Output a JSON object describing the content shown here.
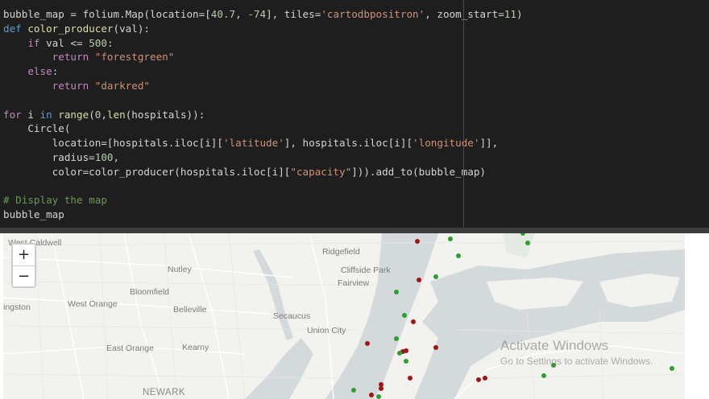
{
  "code_cell": {
    "lines": [
      [
        {
          "t": "bubble_map = folium.Map(location=[",
          "c": ""
        },
        {
          "t": "40.7",
          "c": "num"
        },
        {
          "t": ", ",
          "c": ""
        },
        {
          "t": "-74",
          "c": "num"
        },
        {
          "t": "], tiles=",
          "c": ""
        },
        {
          "t": "'cartodbpositron'",
          "c": "str"
        },
        {
          "t": ", zoom_start=",
          "c": ""
        },
        {
          "t": "11",
          "c": "num"
        },
        {
          "t": ")",
          "c": ""
        }
      ],
      [
        {
          "t": "def",
          "c": "kw"
        },
        {
          "t": " ",
          "c": ""
        },
        {
          "t": "color_producer",
          "c": "fn"
        },
        {
          "t": "(val):",
          "c": ""
        }
      ],
      [
        {
          "t": "    ",
          "c": ""
        },
        {
          "t": "if",
          "c": "ctrl"
        },
        {
          "t": " val <= ",
          "c": ""
        },
        {
          "t": "500",
          "c": "num"
        },
        {
          "t": ":",
          "c": ""
        }
      ],
      [
        {
          "t": "        ",
          "c": ""
        },
        {
          "t": "return",
          "c": "ctrl"
        },
        {
          "t": " ",
          "c": ""
        },
        {
          "t": "\"forestgreen\"",
          "c": "str"
        }
      ],
      [
        {
          "t": "    ",
          "c": ""
        },
        {
          "t": "else",
          "c": "ctrl"
        },
        {
          "t": ":",
          "c": ""
        }
      ],
      [
        {
          "t": "        ",
          "c": ""
        },
        {
          "t": "return",
          "c": "ctrl"
        },
        {
          "t": " ",
          "c": ""
        },
        {
          "t": "\"darkred\"",
          "c": "str"
        }
      ],
      [],
      [
        {
          "t": "for",
          "c": "ctrl"
        },
        {
          "t": " i ",
          "c": ""
        },
        {
          "t": "in",
          "c": "kw"
        },
        {
          "t": " ",
          "c": ""
        },
        {
          "t": "range",
          "c": "fn"
        },
        {
          "t": "(",
          "c": ""
        },
        {
          "t": "0",
          "c": "num"
        },
        {
          "t": ",",
          "c": ""
        },
        {
          "t": "len",
          "c": "fn"
        },
        {
          "t": "(hospitals)):",
          "c": ""
        }
      ],
      [
        {
          "t": "    Circle(",
          "c": ""
        }
      ],
      [
        {
          "t": "        location=[hospitals.iloc[i][",
          "c": ""
        },
        {
          "t": "'latitude'",
          "c": "str"
        },
        {
          "t": "], hospitals.iloc[i][",
          "c": ""
        },
        {
          "t": "'longitude'",
          "c": "str"
        },
        {
          "t": "]],",
          "c": ""
        }
      ],
      [
        {
          "t": "        radius=",
          "c": ""
        },
        {
          "t": "100",
          "c": "num"
        },
        {
          "t": ",",
          "c": ""
        }
      ],
      [
        {
          "t": "        color=color_producer(hospitals.iloc[i][",
          "c": ""
        },
        {
          "t": "\"capacity\"",
          "c": "str"
        },
        {
          "t": "])).add_to(bubble_map)",
          "c": ""
        }
      ],
      [],
      [
        {
          "t": "# Display the map",
          "c": "cm"
        }
      ],
      [
        {
          "t": "bubble_map",
          "c": ""
        }
      ]
    ]
  },
  "map": {
    "zoom_in_label": "+",
    "zoom_out_label": "−",
    "places": {
      "west_caldwell": "West Caldwell",
      "ridgefield": "Ridgefield",
      "nutley": "Nutley",
      "cliffside_park": "Cliffside Park",
      "fairview": "Fairview",
      "bloomfield": "Bloomfield",
      "livingston": "ingston",
      "west_orange": "West Orange",
      "belleville": "Belleville",
      "secaucus": "Secaucus",
      "union_city": "Union City",
      "east_orange": "East Orange",
      "kearny": "Kearny",
      "newark": "NEWARK"
    },
    "marker_colors": {
      "forestgreen": "#2e9e2e",
      "darkred": "#a01515"
    },
    "markers": [
      {
        "c": "darkred"
      },
      {
        "c": "forestgreen"
      },
      {
        "c": "forestgreen"
      },
      {
        "c": "forestgreen"
      },
      {
        "c": "darkred"
      },
      {
        "c": "forestgreen"
      },
      {
        "c": "forestgreen"
      },
      {
        "c": "forestgreen"
      },
      {
        "c": "forestgreen"
      },
      {
        "c": "darkred"
      },
      {
        "c": "forestgreen"
      },
      {
        "c": "darkred"
      },
      {
        "c": "darkred"
      },
      {
        "c": "darkred"
      },
      {
        "c": "forestgreen"
      },
      {
        "c": "darkred"
      },
      {
        "c": "forestgreen"
      },
      {
        "c": "forestgreen"
      },
      {
        "c": "forestgreen"
      },
      {
        "c": "darkred"
      },
      {
        "c": "darkred"
      },
      {
        "c": "forestgreen"
      },
      {
        "c": "darkred"
      },
      {
        "c": "darkred"
      },
      {
        "c": "forestgreen"
      },
      {
        "c": "forestgreen"
      },
      {
        "c": "darkred"
      },
      {
        "c": "darkred"
      }
    ]
  },
  "watermark": {
    "title": "Activate Windows",
    "subtitle": "Go to Settings to activate Windows."
  },
  "colors": {
    "editor_bg": "#1e1e1e",
    "map_water": "#d4dadc",
    "map_land": "#f2f2ef"
  }
}
